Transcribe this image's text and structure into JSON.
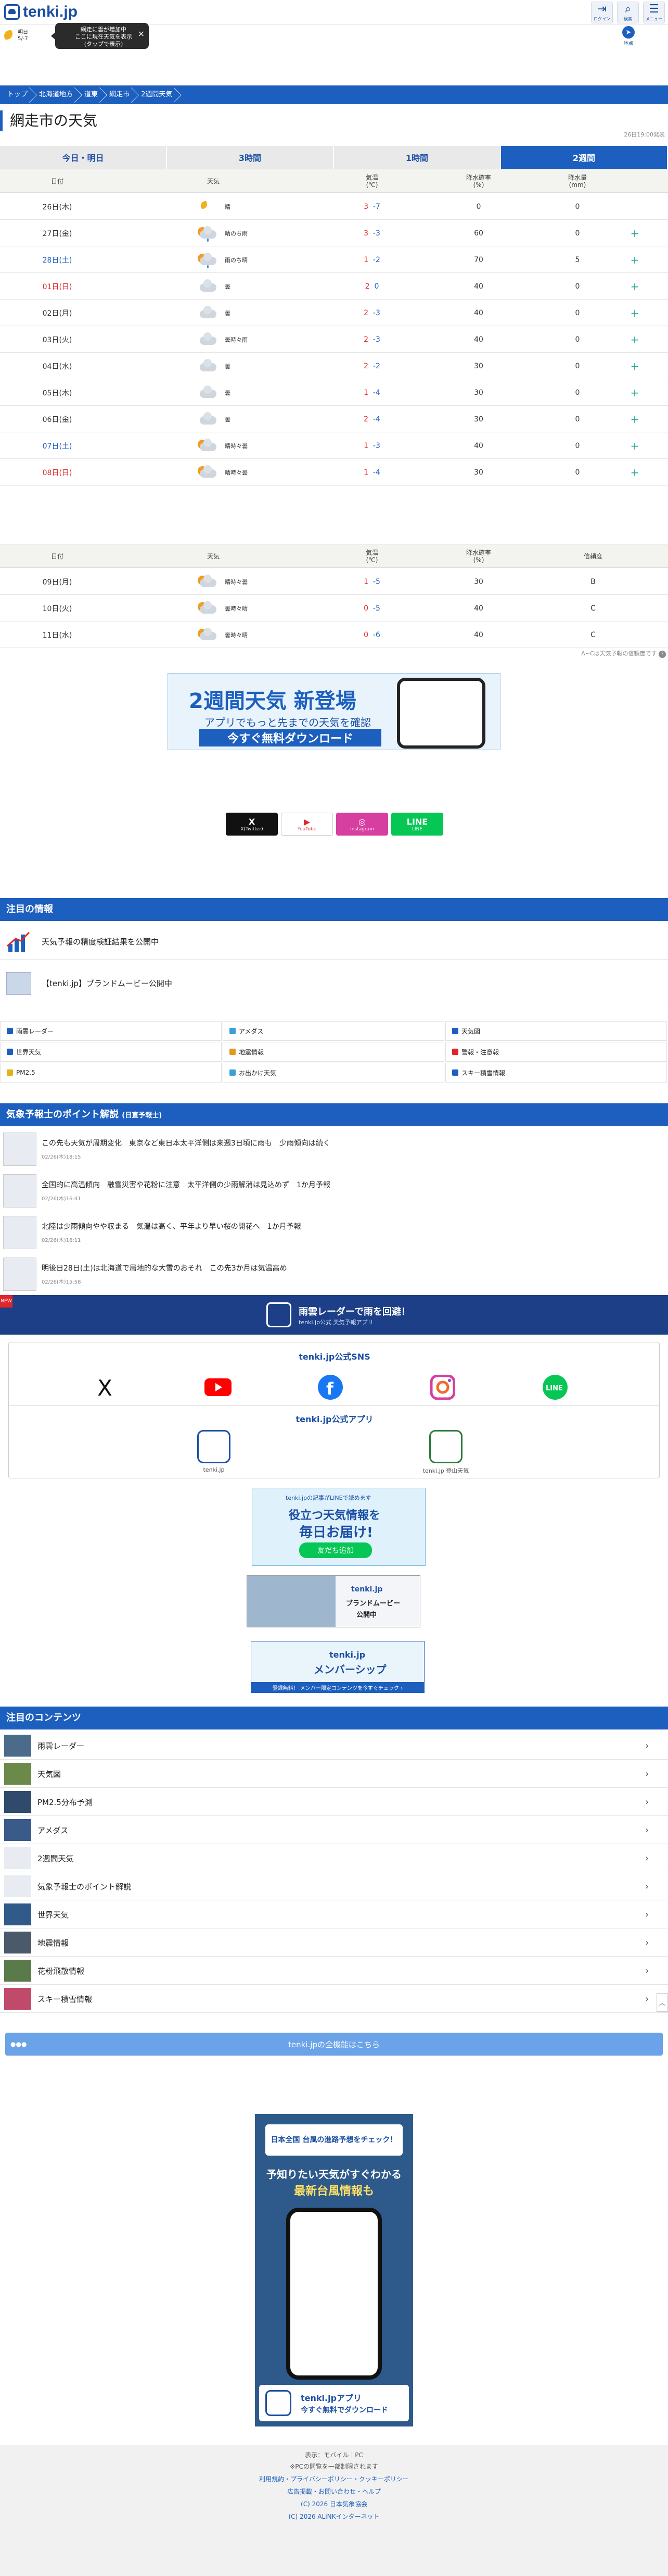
{
  "header": {
    "logo_text": "tenki.jp",
    "btn_login": "ログイン",
    "btn_search": "検索",
    "btn_menu": "メニュー"
  },
  "pill": {
    "time": "明日",
    "temp": "5/-7",
    "tooltip_1": "網走に雲が増加中",
    "tooltip_2": "ここに現在天気を表示",
    "tooltip_3": "(タップで表示)",
    "close": "×",
    "loc_label": "地点"
  },
  "breadcrumb": [
    "トップ",
    "北海道地方",
    "道東",
    "網走市",
    "2週間天気"
  ],
  "page_title": "網走市の天気",
  "updated": "26日19:00発表",
  "tabs": [
    "今日・明日",
    "3時間",
    "1時間",
    "2週間"
  ],
  "table1": {
    "headers": [
      "日付",
      "天気",
      "気温\n(℃)",
      "降水確率\n(%)",
      "降水量\n(mm)"
    ],
    "rows": [
      {
        "date": "26日(木)",
        "cls": "",
        "icon": "moon",
        "wx": "晴",
        "hi": "3",
        "lo": "-7",
        "pop": "0",
        "mm": "0",
        "plus": ""
      },
      {
        "date": "27日(金)",
        "cls": "",
        "icon": "sun-cloud-rain",
        "wx": "晴のち雨",
        "hi": "3",
        "lo": "-3",
        "pop": "60",
        "mm": "0",
        "plus": "+"
      },
      {
        "date": "28日(土)",
        "cls": "sat",
        "icon": "sun-cloud-rain",
        "wx": "雨のち晴",
        "hi": "1",
        "lo": "-2",
        "pop": "70",
        "mm": "5",
        "plus": "+"
      },
      {
        "date": "01日(日)",
        "cls": "sun-d",
        "icon": "cloud",
        "wx": "曇",
        "hi": "2",
        "lo": "0",
        "pop": "40",
        "mm": "0",
        "plus": "+"
      },
      {
        "date": "02日(月)",
        "cls": "",
        "icon": "cloud",
        "wx": "曇",
        "hi": "2",
        "lo": "-3",
        "pop": "40",
        "mm": "0",
        "plus": "+"
      },
      {
        "date": "03日(火)",
        "cls": "",
        "icon": "cloud",
        "wx": "曇時々雨",
        "hi": "2",
        "lo": "-3",
        "pop": "40",
        "mm": "0",
        "plus": "+"
      },
      {
        "date": "04日(水)",
        "cls": "",
        "icon": "cloud",
        "wx": "曇",
        "hi": "2",
        "lo": "-2",
        "pop": "30",
        "mm": "0",
        "plus": "+"
      },
      {
        "date": "05日(木)",
        "cls": "",
        "icon": "cloud",
        "wx": "曇",
        "hi": "1",
        "lo": "-4",
        "pop": "30",
        "mm": "0",
        "plus": "+"
      },
      {
        "date": "06日(金)",
        "cls": "",
        "icon": "cloud",
        "wx": "曇",
        "hi": "2",
        "lo": "-4",
        "pop": "30",
        "mm": "0",
        "plus": "+"
      },
      {
        "date": "07日(土)",
        "cls": "sat",
        "icon": "sun-cloud",
        "wx": "晴時々曇",
        "hi": "1",
        "lo": "-3",
        "pop": "40",
        "mm": "0",
        "plus": "+"
      },
      {
        "date": "08日(日)",
        "cls": "sun-d",
        "icon": "sun-cloud",
        "wx": "晴時々曇",
        "hi": "1",
        "lo": "-4",
        "pop": "30",
        "mm": "0",
        "plus": "+"
      }
    ]
  },
  "table2": {
    "headers": [
      "日付",
      "天気",
      "気温\n(℃)",
      "降水確率\n(%)",
      "信頼度"
    ],
    "rows": [
      {
        "date": "09日(月)",
        "cls": "",
        "icon": "sun-cloud",
        "wx": "晴時々曇",
        "hi": "1",
        "lo": "-5",
        "pop": "30",
        "rel": "B"
      },
      {
        "date": "10日(火)",
        "cls": "",
        "icon": "sun-cloud",
        "wx": "曇時々晴",
        "hi": "0",
        "lo": "-5",
        "pop": "40",
        "rel": "C"
      },
      {
        "date": "11日(水)",
        "cls": "",
        "icon": "sun-cloud",
        "wx": "曇時々晴",
        "hi": "0",
        "lo": "-6",
        "pop": "40",
        "rel": "C"
      }
    ]
  },
  "note2": "A~Cは天気予報の信頼度です",
  "dl_banner": {
    "t1": "2週間天気 新登場",
    "t2": "アプリでもっと先までの天気を確認",
    "btn": "今すぐ無料ダウンロード"
  },
  "social_small": [
    {
      "name": "X",
      "sub": "X(Twitter)",
      "color": "#111111"
    },
    {
      "name": "▶",
      "sub": "YouTube",
      "color": "#ffffff"
    },
    {
      "name": "◎",
      "sub": "Instagram",
      "color": "#d63fa0"
    },
    {
      "name": "LINE",
      "sub": "LINE",
      "color": "#06c755"
    }
  ],
  "featured": {
    "title": "注目の情報",
    "items": [
      "天気予報の精度検証結果を公開中",
      "【tenki.jp】ブランドムービー公開中"
    ]
  },
  "links": [
    {
      "label": "雨雲レーダー",
      "color": "#1c5fbf"
    },
    {
      "label": "アメダス",
      "color": "#3aa0d8"
    },
    {
      "label": "天気図",
      "color": "#1c5fbf"
    },
    {
      "label": "世界天気",
      "color": "#1c5fbf"
    },
    {
      "label": "地震情報",
      "color": "#e09a1c"
    },
    {
      "label": "警報・注意報",
      "color": "#e0262b"
    },
    {
      "label": "PM2.5",
      "color": "#e0b21c"
    },
    {
      "label": "お出かけ天気",
      "color": "#3aa0d8"
    },
    {
      "label": "スキー積雪情報",
      "color": "#1c5fbf"
    }
  ],
  "points": {
    "title": "気象予報士のポイント解説",
    "sub": "(日直予報士)",
    "items": [
      {
        "t": "この先も天気が周期変化　東京など東日本太平洋側は来週3日頃に雨も　少雨傾向は続く",
        "d": "02/26(木)18:15"
      },
      {
        "t": "全国的に高温傾向　融雪災害や花粉に注意　太平洋側の少雨解消は見込めず　1か月予報",
        "d": "02/26(木)16:41"
      },
      {
        "t": "北陸は少雨傾向やや収まる　気温は高く、平年より早い桜の開花へ　1か月予報",
        "d": "02/26(木)16:11"
      },
      {
        "t": "明後日28日(土)は北海道で局地的な大雪のおそれ　この先3か月は気温高め",
        "d": "02/26(木)15:58"
      }
    ]
  },
  "radar": {
    "t1": "雨雲レーダーで雨を回避！",
    "t2": "tenki.jp公式 天気予報アプリ",
    "badge": "NEW"
  },
  "sns": {
    "title": "tenki.jp公式SNS",
    "app_title": "tenki.jp公式アプリ",
    "app1": "tenki.jp",
    "app2": "tenki.jp 登山天気"
  },
  "small_banners": {
    "line1": "tenki.jpの記事がLINEで読めます",
    "line2": "役立つ天気情報を",
    "line3": "毎日お届け!",
    "line4": "友だち追加",
    "brand1": "tenki.jp",
    "brand2": "ブランドムービー",
    "brand3": "公開中",
    "mem1": "tenki.jp",
    "mem2": "メンバーシップ",
    "mem3": "登録無料！ メンバー限定コンテンツを今すぐチェック ›"
  },
  "contents": {
    "title": "注目のコンテンツ",
    "items": [
      "雨雲レーダー",
      "天気図",
      "PM2.5分布予測",
      "アメダス",
      "2週間天気",
      "気象予報士のポイント解説",
      "世界天気",
      "地震情報",
      "花粉飛散情報",
      "スキー積雪情報"
    ],
    "all": "tenki.jpの全機能はこちら"
  },
  "bigad": {
    "t1": "日本全国 台風の進路予想をチェック！",
    "t2": "予知りたい天気がすぐわかる",
    "t3": "最新台風情報も",
    "f1": "tenki.jpアプリ",
    "f2": "今すぐ無料でダウンロード"
  },
  "footer": {
    "l1": "表示：モバイル｜PC",
    "l2": "※PCの閲覧を一部制限されます",
    "l3": "利用規約・プライバシーポリシー・クッキーポリシー",
    "l4": "広告掲載・お問い合わせ・ヘルプ",
    "l5": "(C) 2026 日本気象協会",
    "l6": "(C) 2026 ALiNKインターネット"
  }
}
